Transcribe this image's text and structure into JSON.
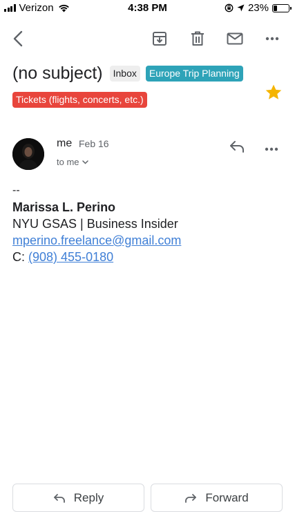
{
  "status_bar": {
    "carrier": "Verizon",
    "time": "4:38 PM",
    "battery_percent": "23%",
    "battery_level": 0.23
  },
  "toolbar": {
    "icons": [
      "back-icon",
      "archive-icon",
      "trash-icon",
      "mail-icon",
      "more-icon"
    ]
  },
  "email": {
    "subject": "(no subject)",
    "labels": [
      {
        "text": "Inbox",
        "color": "#eeeeee"
      },
      {
        "text": "Europe Trip Planning",
        "color": "#2ea3b8"
      },
      {
        "text": "Tickets (flights, concerts, etc.)",
        "color": "#e8453c"
      }
    ],
    "starred": true,
    "star_color": "#f5b400"
  },
  "sender": {
    "name": "me",
    "date": "Feb 16",
    "recipient": "to me"
  },
  "body": {
    "dashes": "--",
    "sig_name": "Marissa L. Perino",
    "sig_affiliation": "NYU GSAS | Business Insider",
    "sig_email": "mperino.freelance@gmail.com",
    "phone_prefix": "C:",
    "phone": "(908) 455-0180",
    "link_color": "#3f7fd6"
  },
  "actions": {
    "reply_label": "Reply",
    "forward_label": "Forward"
  }
}
